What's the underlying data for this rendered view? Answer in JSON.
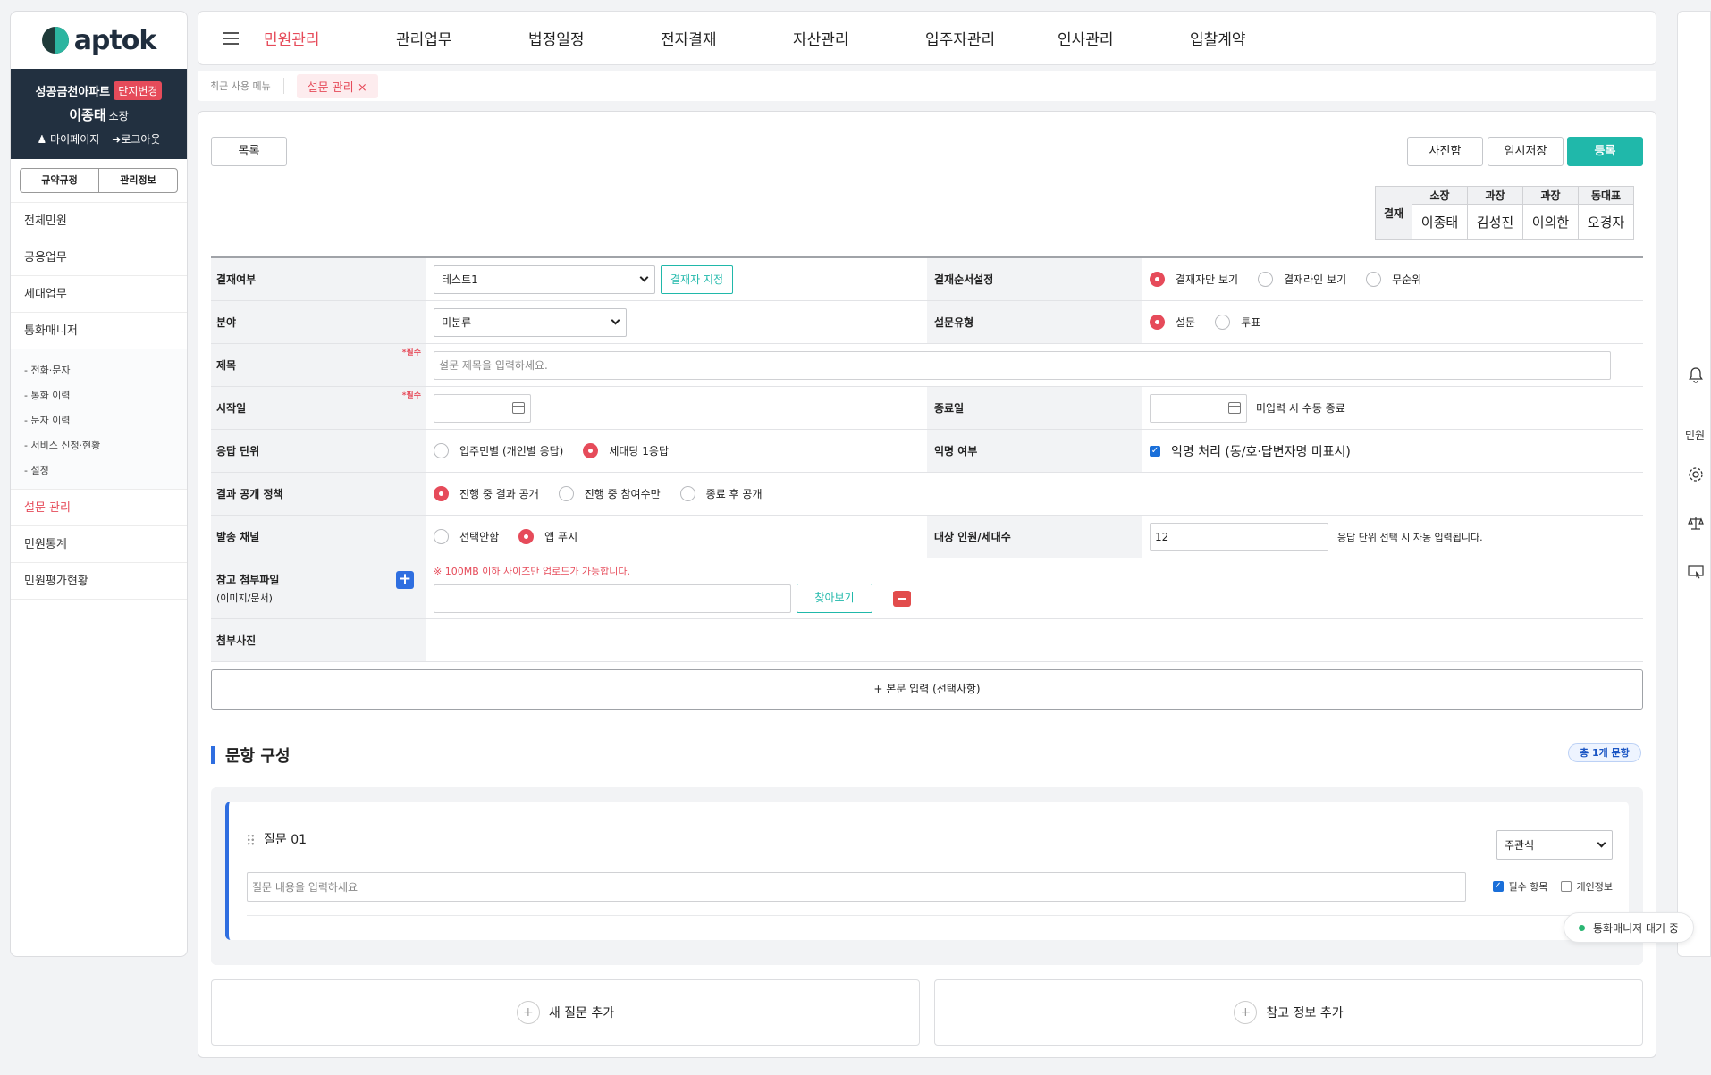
{
  "brand": {
    "logo_text": "aptok"
  },
  "profile": {
    "complex_name": "성공금천아파트",
    "change_label": "단지변경",
    "user_name": "이종태",
    "user_role": "소장",
    "mypage": "마이페이지",
    "logout": "로그아웃"
  },
  "sidebar_tabs": [
    "규약규정",
    "관리정보"
  ],
  "sidebar": {
    "items_top": [
      "전체민원",
      "공용업무",
      "세대업무",
      "통화매니저"
    ],
    "submenu": [
      "- 전화·문자",
      "- 통화 이력",
      "- 문자 이력",
      "- 서비스 신청·현황",
      "- 설정"
    ],
    "active": "설문 관리",
    "items_bottom": [
      "민원통계",
      "민원평가현황"
    ]
  },
  "nav": [
    "민원관리",
    "관리업무",
    "법정일정",
    "전자결재",
    "자산관리",
    "입주자관리",
    "인사관리",
    "입찰계약"
  ],
  "recent": {
    "label": "최근 사용 메뉴",
    "chip": "설문 관리",
    "close": "×"
  },
  "buttons": {
    "list": "목록",
    "photo": "사진함",
    "temp": "임시저장",
    "submit": "등록"
  },
  "approval": {
    "label": "결재",
    "roles": [
      "소장",
      "과장",
      "과장",
      "동대표"
    ],
    "names": [
      "이종태",
      "김성진",
      "이의한",
      "오경자"
    ]
  },
  "form": {
    "approval_flag": {
      "label": "결재여부",
      "value": "테스트1",
      "assign": "결재자 지정"
    },
    "approval_order": {
      "label": "결재순서설정",
      "options": [
        "결재자만 보기",
        "결재라인 보기",
        "무순위"
      ],
      "selected": 0
    },
    "field": {
      "label": "분야",
      "value": "미분류"
    },
    "survey_type": {
      "label": "설문유형",
      "options": [
        "설문",
        "투표"
      ],
      "selected": 0
    },
    "title": {
      "label": "제목",
      "required": "*필수",
      "placeholder": "설문 제목을 입력하세요."
    },
    "start": {
      "label": "시작일",
      "required": "*필수"
    },
    "end": {
      "label": "종료일",
      "note": "미입력 시 수동 종료"
    },
    "response_unit": {
      "label": "응답 단위",
      "options": [
        "입주민별 (개인별 응답)",
        "세대당 1응답"
      ],
      "selected": 1
    },
    "anonymous": {
      "label": "익명 여부",
      "text": "익명 처리 (동/호·답변자명 미표시)",
      "checked": true
    },
    "result_policy": {
      "label": "결과 공개 정책",
      "options": [
        "진행 중 결과 공개",
        "진행 중 참여수만",
        "종료 후 공개"
      ],
      "selected": 0
    },
    "channel": {
      "label": "발송 채널",
      "options": [
        "선택안함",
        "앱 푸시"
      ],
      "selected": 1
    },
    "target": {
      "label": "대상 인원/세대수",
      "value": "12",
      "note": "응답 단위 선택 시 자동 입력됩니다."
    },
    "attach": {
      "label": "참고 첨부파일",
      "sublabel": "(이미지/문서)",
      "notice": "※ 100MB 이하 사이즈만 업로드가 가능합니다.",
      "browse": "찾아보기"
    },
    "photos": {
      "label": "첨부사진"
    }
  },
  "body_button": "+ 본문 입력 (선택사항)",
  "questions": {
    "title": "문항 구성",
    "count": "총 1개 문항",
    "items": [
      {
        "label": "질문 01",
        "type": "주관식",
        "placeholder": "질문 내용을 입력하세요",
        "required_label": "필수 항목",
        "required": true,
        "privacy_label": "개인정보",
        "privacy": false
      }
    ],
    "add_question": "새 질문 추가",
    "add_info": "참고 정보 추가"
  },
  "rail": {
    "label": "민원"
  },
  "toast": {
    "text": "통화매니저 대기 중"
  },
  "colors": {
    "accent": "#e64b5a",
    "primary": "#20b8aa",
    "blue": "#2f6ee0",
    "navy": "#223040"
  }
}
